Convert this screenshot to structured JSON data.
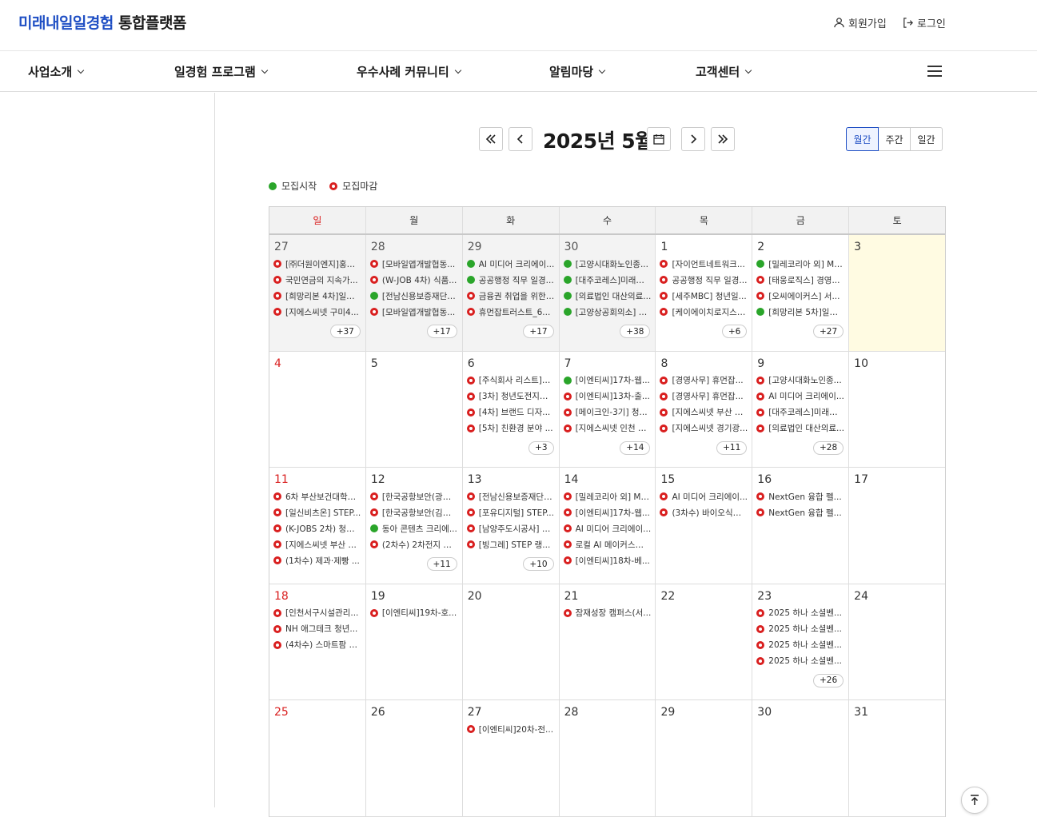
{
  "header": {
    "logo_blue": "미래내일일경험",
    "logo_dark": "통합플랫폼",
    "signup": "회원가입",
    "login": "로그인"
  },
  "gnb": [
    "사업소개",
    "일경험 프로그램",
    "우수사례 커뮤니티",
    "알림마당",
    "고객센터"
  ],
  "toolbar": {
    "month_title": "2025년 5월",
    "views": [
      "월간",
      "주간",
      "일간"
    ],
    "active_view": "월간"
  },
  "legend": {
    "start": "모집시작",
    "end": "모집마감"
  },
  "weekdays": [
    "일",
    "월",
    "화",
    "수",
    "목",
    "금",
    "토"
  ],
  "weeks": [
    [
      {
        "day": "27",
        "other": true,
        "events": [
          [
            "e",
            "[㈜더원이엔지]홍성..."
          ],
          [
            "e",
            "국민연금의 지속가..."
          ],
          [
            "e",
            "[희망리본 4차]일반..."
          ],
          [
            "e",
            "[지에스씨넷 구미4..."
          ]
        ],
        "more": "+37"
      },
      {
        "day": "28",
        "other": true,
        "events": [
          [
            "e",
            "[모바일앱개발협동..."
          ],
          [
            "e",
            "(W-JOB 4차) 식품..."
          ],
          [
            "s",
            "[전남신용보증재단]..."
          ],
          [
            "e",
            "[모바일앱개발협동..."
          ]
        ],
        "more": "+17"
      },
      {
        "day": "29",
        "other": true,
        "events": [
          [
            "s",
            "AI 미디어 크리에이..."
          ],
          [
            "s",
            "공공행정 직무 일경..."
          ],
          [
            "e",
            "금융권 취업을 위한 ..."
          ],
          [
            "e",
            "휴먼잡트러스트_6..."
          ]
        ],
        "more": "+17"
      },
      {
        "day": "30",
        "other": true,
        "events": [
          [
            "s",
            "[고양시대화노인종..."
          ],
          [
            "s",
            "[대주코레스]미래내..."
          ],
          [
            "s",
            "[의료법인 대산의료..."
          ],
          [
            "s",
            "[고양상공회의소] S..."
          ]
        ],
        "more": "+38"
      },
      {
        "day": "1",
        "events": [
          [
            "e",
            "[자이언트네트워크..."
          ],
          [
            "e",
            "공공행정 직무 일경..."
          ],
          [
            "e",
            "[세주MBC] 청년일..."
          ],
          [
            "e",
            "[케이에이치로지스]..."
          ]
        ],
        "more": "+6"
      },
      {
        "day": "2",
        "events": [
          [
            "s",
            "[밀레코리아 외] My..."
          ],
          [
            "e",
            "[태웅로직스] 경영..."
          ],
          [
            "e",
            "[오씨에이커스] 서..."
          ],
          [
            "s",
            "[희망리본 5차]일반..."
          ]
        ],
        "more": "+27"
      },
      {
        "day": "3",
        "today": true,
        "events": [],
        "more": ""
      }
    ],
    [
      {
        "day": "4",
        "sunday": true,
        "events": [],
        "more": ""
      },
      {
        "day": "5",
        "events": [],
        "more": ""
      },
      {
        "day": "6",
        "events": [
          [
            "e",
            "[주식회사 리스트]2..."
          ],
          [
            "e",
            "[3차] 청년도전지원..."
          ],
          [
            "e",
            "[4차] 브랜드 디자..."
          ],
          [
            "e",
            "[5차] 친환경 분야 ..."
          ]
        ],
        "more": "+3"
      },
      {
        "day": "7",
        "events": [
          [
            "s",
            "[이엔티씨]17차-웹..."
          ],
          [
            "e",
            "[이엔티씨]13차-출..."
          ],
          [
            "e",
            "[메이크인-3기] 청..."
          ],
          [
            "e",
            "[지에스씨넷 인천 1..."
          ]
        ],
        "more": "+14"
      },
      {
        "day": "8",
        "events": [
          [
            "e",
            "[경영사무] 휴먼잡..."
          ],
          [
            "e",
            "[경영사무] 휴먼잡..."
          ],
          [
            "e",
            "[지에스씨넷 부산 4..."
          ],
          [
            "e",
            "[지에스씨넷 경기광..."
          ]
        ],
        "more": "+11"
      },
      {
        "day": "9",
        "events": [
          [
            "e",
            "[고양시대화노인종..."
          ],
          [
            "e",
            "AI 미디어 크리에이..."
          ],
          [
            "e",
            "[대주코레스]미래내..."
          ],
          [
            "e",
            "[의료법인 대산의료..."
          ]
        ],
        "more": "+28"
      },
      {
        "day": "10",
        "events": [],
        "more": ""
      }
    ],
    [
      {
        "day": "11",
        "sunday": true,
        "events": [
          [
            "e",
            "6차 부산보건대학교..."
          ],
          [
            "e",
            "[일신비츠온] STEP..."
          ],
          [
            "e",
            "(K-JOBS 2차) 청년..."
          ],
          [
            "e",
            "[지에스씨넷 부산 6..."
          ],
          [
            "e",
            "(1차수) 제과·제빵 ..."
          ]
        ],
        "more": ""
      },
      {
        "day": "12",
        "events": [
          [
            "e",
            "[한국공항보안(광주..."
          ],
          [
            "e",
            "[한국공항보안(김포..."
          ],
          [
            "s",
            "동아 콘텐츠 크리에..."
          ],
          [
            "e",
            "(2차수) 2차전지 일..."
          ]
        ],
        "more": "+11"
      },
      {
        "day": "13",
        "events": [
          [
            "e",
            "[전남신용보증재단]..."
          ],
          [
            "e",
            "[포유디지털] STEP..."
          ],
          [
            "e",
            "[남양주도시공사] S..."
          ],
          [
            "e",
            "[빙그레] STEP 랭..."
          ]
        ],
        "more": "+10"
      },
      {
        "day": "14",
        "events": [
          [
            "e",
            "[밀레코리아 외] My..."
          ],
          [
            "e",
            "[이엔티씨]17차-웹..."
          ],
          [
            "e",
            "AI 미디어 크리에이..."
          ],
          [
            "e",
            "로컬 AI 메이커스랩 ..."
          ],
          [
            "e",
            "[이엔티씨]18차-베..."
          ]
        ],
        "more": ""
      },
      {
        "day": "15",
        "events": [
          [
            "e",
            "AI 미디어 크리에이..."
          ],
          [
            "e",
            "(3차수) 바이오식품..."
          ]
        ],
        "more": ""
      },
      {
        "day": "16",
        "events": [
          [
            "e",
            "NextGen 융합 펠..."
          ],
          [
            "e",
            "NextGen 융합 펠..."
          ]
        ],
        "more": ""
      },
      {
        "day": "17",
        "events": [],
        "more": ""
      }
    ],
    [
      {
        "day": "18",
        "sunday": true,
        "events": [
          [
            "e",
            "[인천서구시설관리..."
          ],
          [
            "e",
            "NH 애그테크 청년..."
          ],
          [
            "e",
            "(4차수) 스마트팜 일..."
          ]
        ],
        "more": ""
      },
      {
        "day": "19",
        "events": [
          [
            "e",
            "[이엔티씨]19차-호..."
          ]
        ],
        "more": ""
      },
      {
        "day": "20",
        "events": [],
        "more": ""
      },
      {
        "day": "21",
        "events": [
          [
            "e",
            "잠재성장 캠퍼스(서..."
          ]
        ],
        "more": ""
      },
      {
        "day": "22",
        "events": [],
        "more": ""
      },
      {
        "day": "23",
        "events": [
          [
            "e",
            "2025 하나 소셜벤..."
          ],
          [
            "e",
            "2025 하나 소셜벤..."
          ],
          [
            "e",
            "2025 하나 소셜벤..."
          ],
          [
            "e",
            "2025 하나 소셜벤..."
          ]
        ],
        "more": "+26"
      },
      {
        "day": "24",
        "events": [],
        "more": ""
      }
    ],
    [
      {
        "day": "25",
        "sunday": true,
        "events": [],
        "more": ""
      },
      {
        "day": "26",
        "events": [],
        "more": ""
      },
      {
        "day": "27",
        "events": [
          [
            "e",
            "[이엔티씨]20차-전..."
          ]
        ],
        "more": ""
      },
      {
        "day": "28",
        "events": [],
        "more": ""
      },
      {
        "day": "29",
        "events": [],
        "more": ""
      },
      {
        "day": "30",
        "events": [],
        "more": ""
      },
      {
        "day": "31",
        "events": [],
        "more": ""
      }
    ]
  ]
}
